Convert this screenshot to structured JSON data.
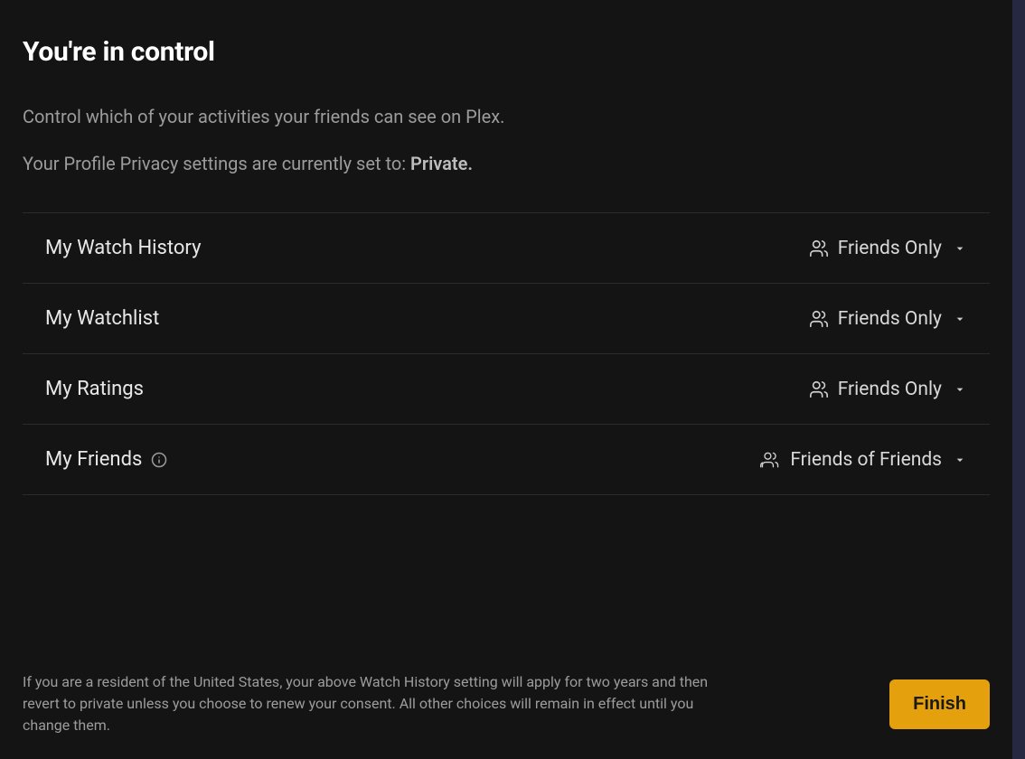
{
  "title": "You're in control",
  "subtitle": "Control which of your activities your friends can see on Plex.",
  "privacy_note_prefix": "Your Profile Privacy settings are currently set to: ",
  "privacy_value": "Private.",
  "settings": [
    {
      "label": "My Watch History",
      "value": "Friends Only",
      "has_info": false,
      "icon": "friends"
    },
    {
      "label": "My Watchlist",
      "value": "Friends Only",
      "has_info": false,
      "icon": "friends"
    },
    {
      "label": "My Ratings",
      "value": "Friends Only",
      "has_info": false,
      "icon": "friends"
    },
    {
      "label": "My Friends",
      "value": "Friends of Friends",
      "has_info": true,
      "icon": "friends-of-friends"
    }
  ],
  "legal_text": "If you are a resident of the United States, your above Watch History setting will apply for two years and then revert to private unless you choose to renew your consent. All other choices will remain in effect until you change them.",
  "finish_label": "Finish",
  "colors": {
    "accent": "#e5a00d",
    "bg": "#141414"
  }
}
